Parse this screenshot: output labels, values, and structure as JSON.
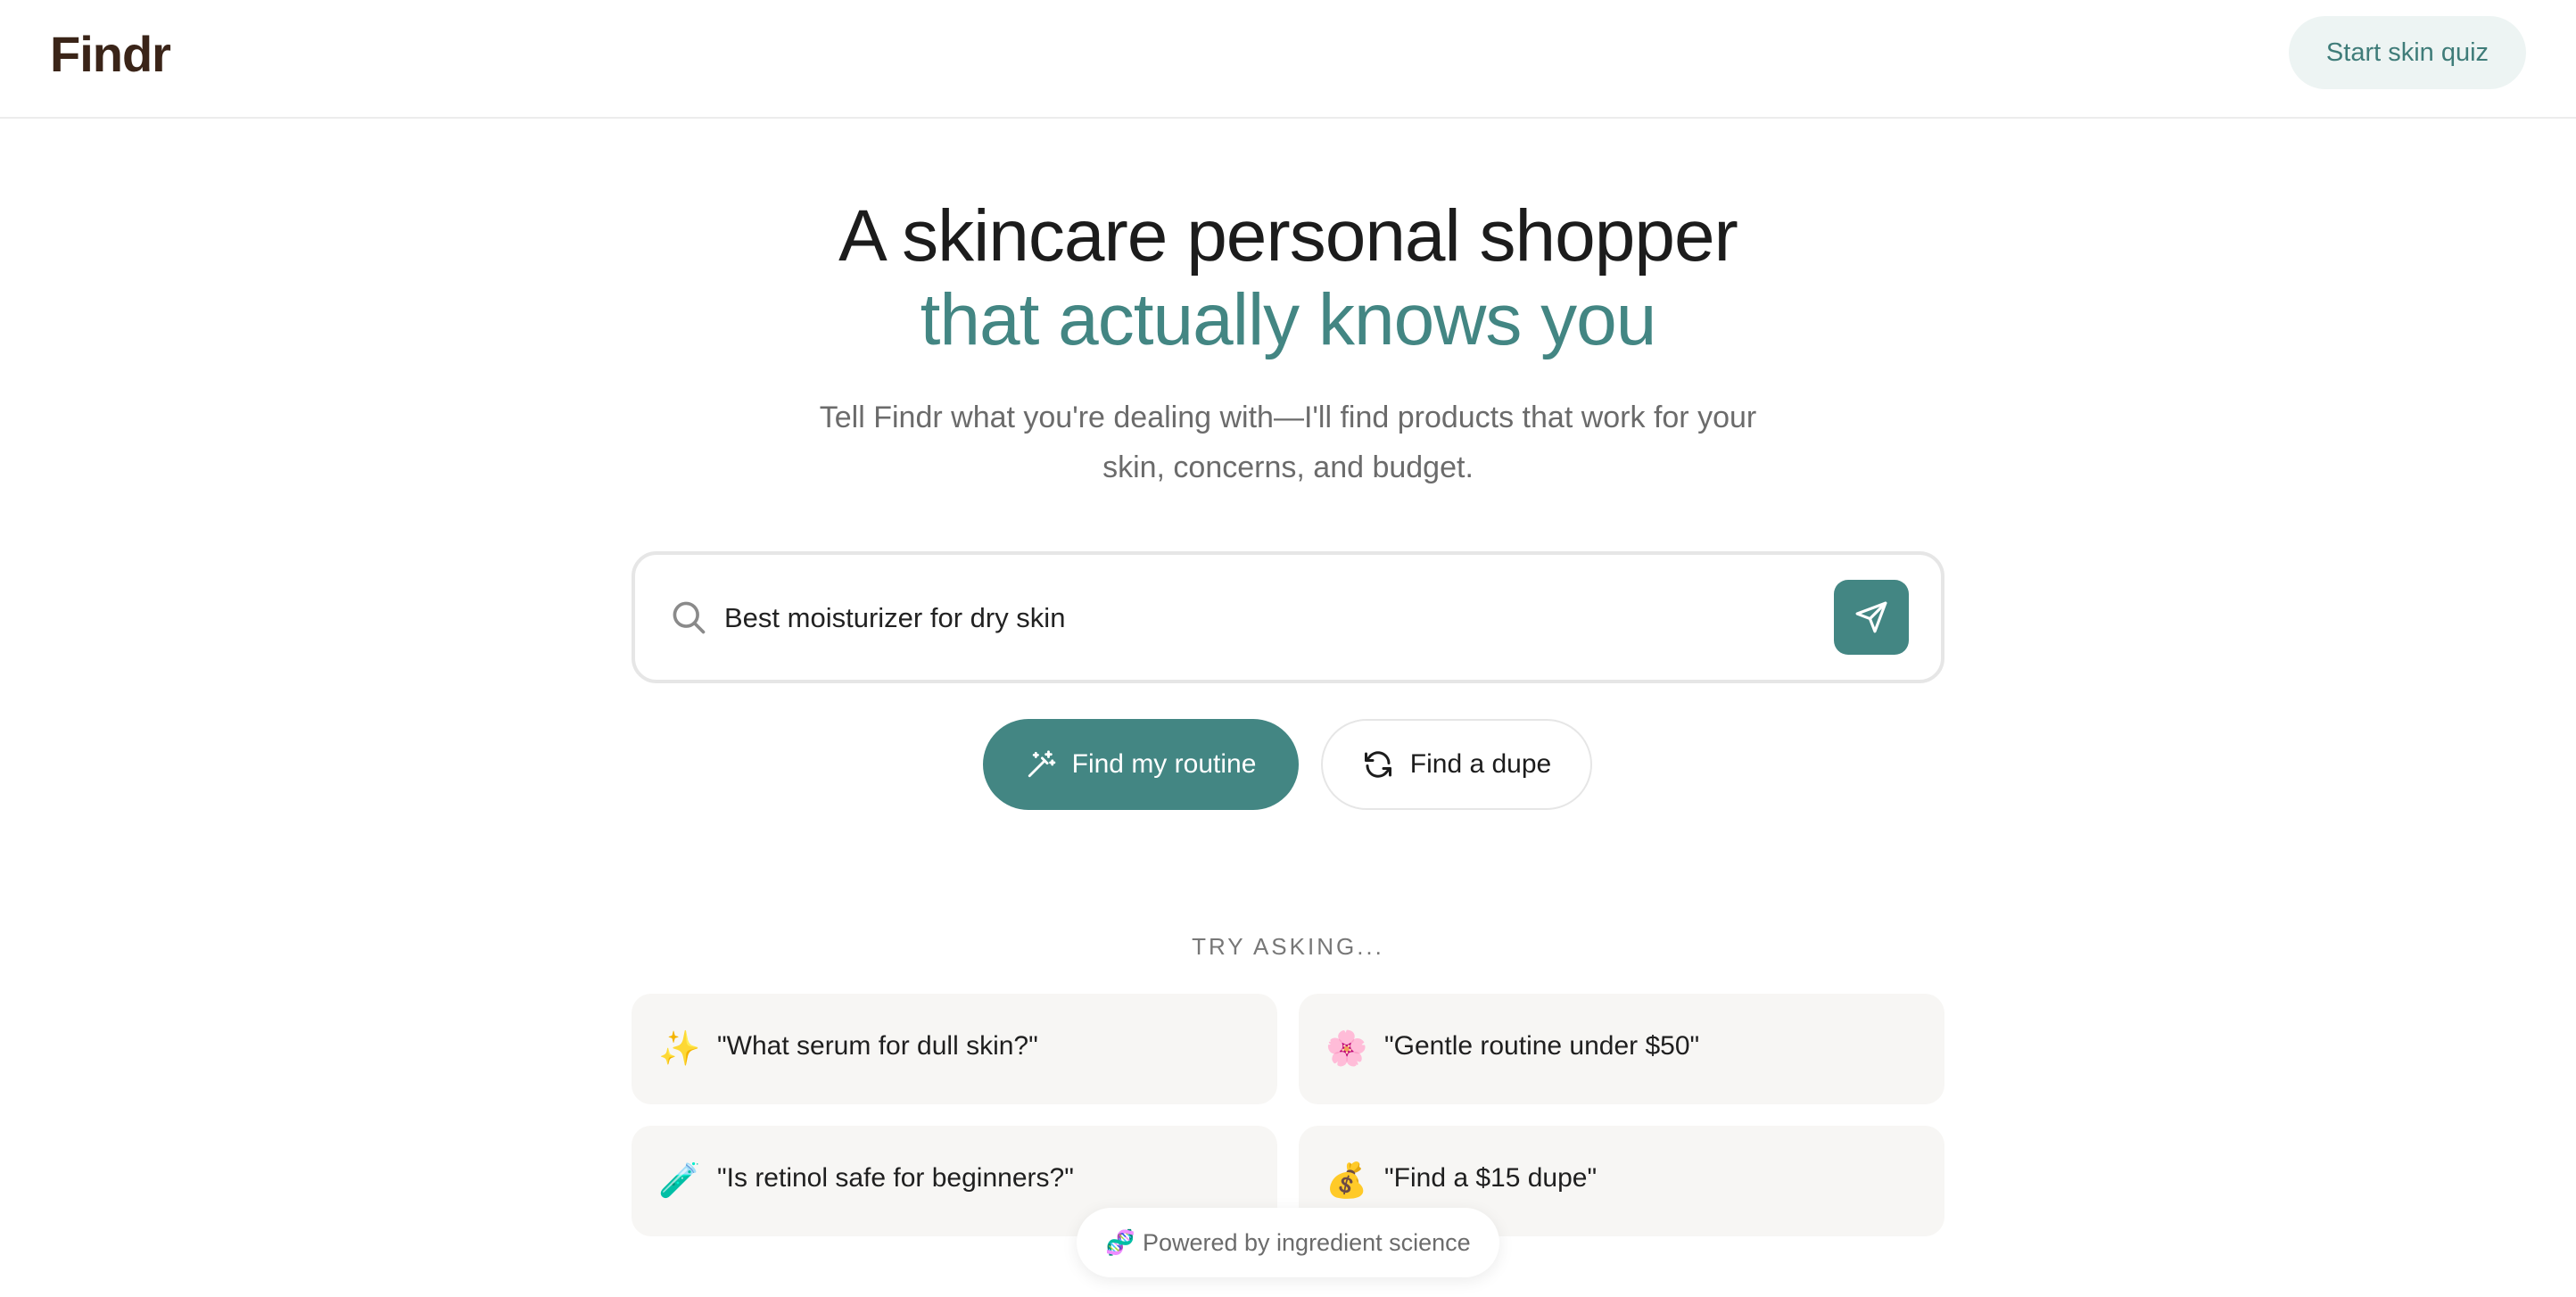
{
  "header": {
    "logo": "Findr",
    "quiz_button": "Start skin quiz"
  },
  "hero": {
    "title_line1": "A skincare personal shopper",
    "title_line2": "that actually knows you",
    "subtitle": "Tell Findr what you're dealing with—I'll find products that work for your skin, concerns, and budget."
  },
  "search": {
    "value": "Best moisturizer for dry skin",
    "icon": "search-icon",
    "send_icon": "send-icon"
  },
  "actions": {
    "routine_label": "Find my routine",
    "routine_icon": "magic-wand-icon",
    "dupe_label": "Find a dupe",
    "dupe_icon": "refresh-icon"
  },
  "suggestions": {
    "heading": "TRY ASKING...",
    "items": [
      {
        "emoji": "✨",
        "text": "\"What serum for dull skin?\""
      },
      {
        "emoji": "🌸",
        "text": "\"Gentle routine under $50\""
      },
      {
        "emoji": "🧪",
        "text": "\"Is retinol safe for beginners?\""
      },
      {
        "emoji": "💰",
        "text": "\"Find a $15 dupe\""
      }
    ]
  },
  "footer": {
    "powered_emoji": "🧬",
    "powered_text": "Powered by ingredient science"
  },
  "colors": {
    "accent": "#438683",
    "logo": "#3a2418",
    "card_bg": "#f7f6f4"
  }
}
